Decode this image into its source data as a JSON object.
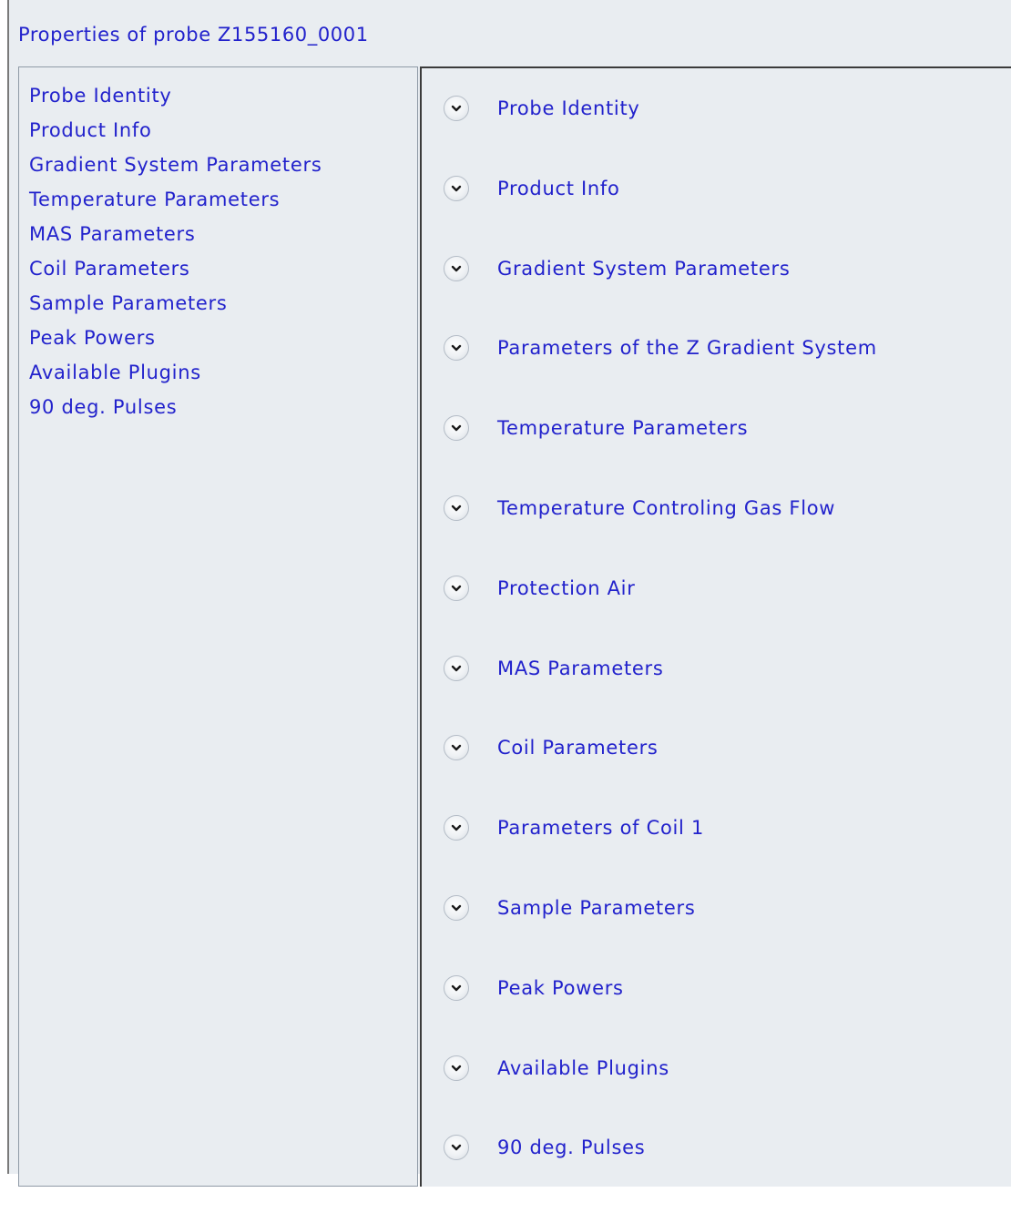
{
  "window": {
    "title": "Properties of probe  Z155160_0001"
  },
  "nav": {
    "items": [
      {
        "label": "Probe Identity"
      },
      {
        "label": "Product Info"
      },
      {
        "label": "Gradient System Parameters"
      },
      {
        "label": "Temperature Parameters"
      },
      {
        "label": "MAS Parameters"
      },
      {
        "label": "Coil Parameters"
      },
      {
        "label": "Sample Parameters"
      },
      {
        "label": "Peak Powers"
      },
      {
        "label": "Available Plugins"
      },
      {
        "label": "90 deg. Pulses"
      }
    ]
  },
  "sections": {
    "icon": "chevron-down-circle-icon",
    "items": [
      {
        "label": "Probe Identity"
      },
      {
        "label": "Product Info"
      },
      {
        "label": "Gradient System Parameters"
      },
      {
        "label": "Parameters of the Z Gradient System"
      },
      {
        "label": "Temperature Parameters"
      },
      {
        "label": "Temperature Controling Gas Flow"
      },
      {
        "label": "Protection Air"
      },
      {
        "label": "MAS Parameters"
      },
      {
        "label": "Coil Parameters"
      },
      {
        "label": "Parameters of Coil 1"
      },
      {
        "label": "Sample Parameters"
      },
      {
        "label": "Peak Powers"
      },
      {
        "label": "Available Plugins"
      },
      {
        "label": "90 deg. Pulses"
      }
    ]
  },
  "colors": {
    "link": "#2222cc",
    "background": "#e9edf1",
    "divider": "#3b3b3b"
  }
}
